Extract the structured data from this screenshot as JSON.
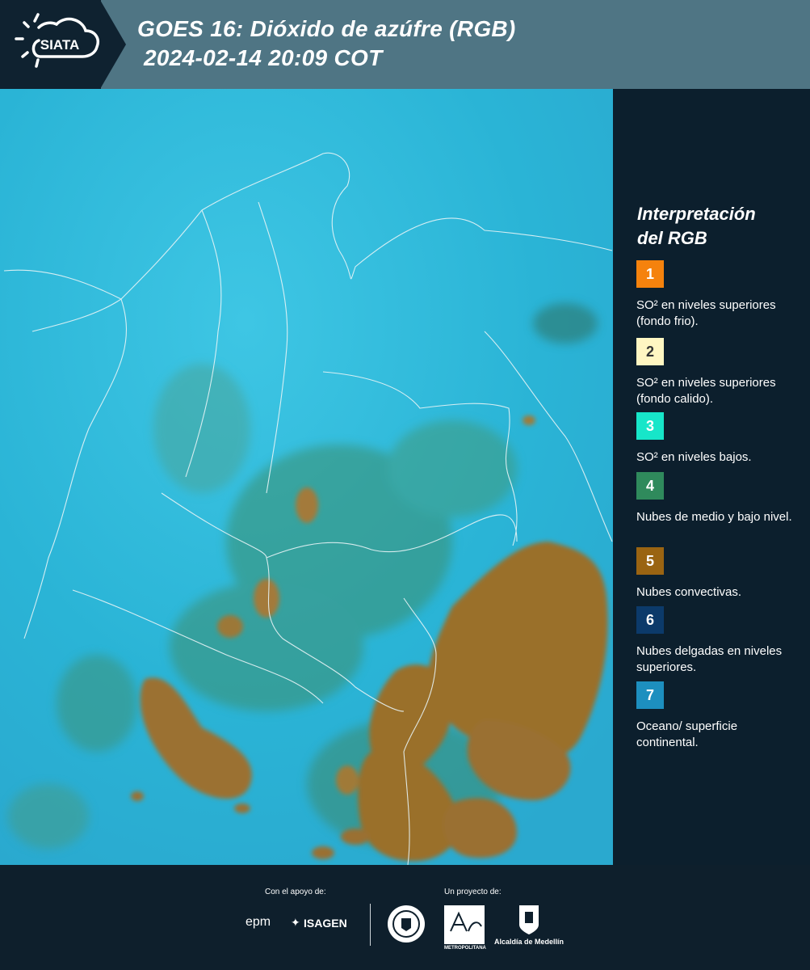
{
  "header": {
    "logo_text": "SIATA",
    "title_line1": "GOES 16: Dióxido de azúfre (RGB)",
    "title_line2": "2024-02-14 20:09 COT"
  },
  "legend": {
    "title_line1": "Interpretación",
    "title_line2": "del RGB",
    "items": [
      {
        "number": "1",
        "text": "SO² en niveles superiores (fondo frio).",
        "color": "#f5820d"
      },
      {
        "number": "2",
        "text": "SO² en niveles superiores (fondo calido).",
        "color": "#fff6c2"
      },
      {
        "number": "3",
        "text": "SO² en niveles bajos.",
        "color": "#17e6c9"
      },
      {
        "number": "4",
        "text": "Nubes de medio y bajo nivel.",
        "color": "#2f8a5c"
      },
      {
        "number": "5",
        "text": "Nubes convectivas.",
        "color": "#9a6412"
      },
      {
        "number": "6",
        "text": "Nubes delgadas en niveles superiores.",
        "color": "#0c3a6a"
      },
      {
        "number": "7",
        "text": "Oceano/ superficie continental.",
        "color": "#1d8fbf"
      }
    ]
  },
  "footer": {
    "support_label": "Con el apoyo de:",
    "project_label": "Un proyecto de:",
    "sponsor1": "epm",
    "sponsor2": "ISAGEN",
    "org1": "METROPOLITANA",
    "org2": "Alcaldía de Medellín"
  }
}
